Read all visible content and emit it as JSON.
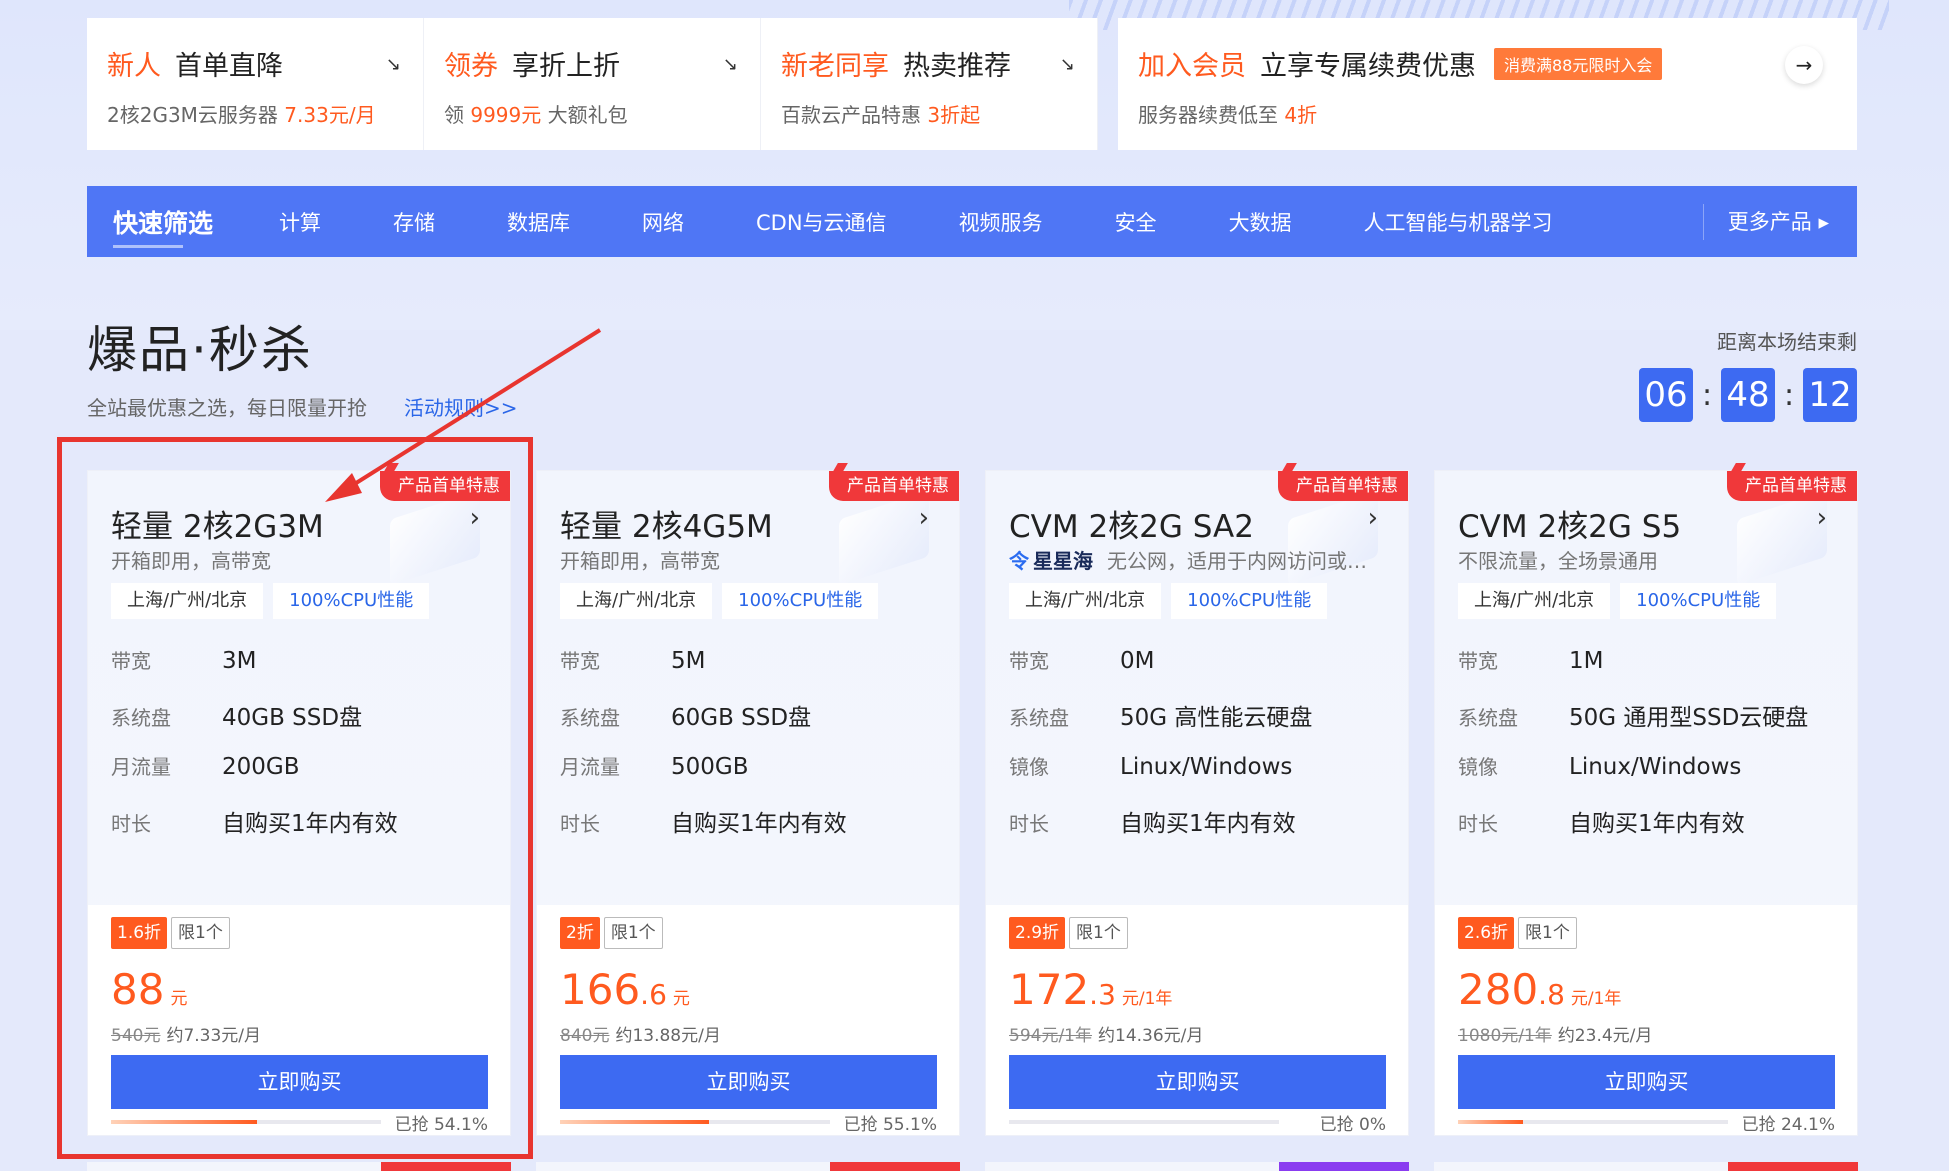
{
  "promos": [
    {
      "hl": "新人",
      "title": "首单直降",
      "sub_pre": "2核2G3M云服务器 ",
      "sub_hl": "7.33元/月",
      "sub_post": "",
      "arrow": "↘"
    },
    {
      "hl": "领券",
      "title": "享折上折",
      "sub_pre": "领 ",
      "sub_hl": "9999元",
      "sub_post": " 大额礼包",
      "arrow": "↘"
    },
    {
      "hl": "新老同享",
      "title": "热卖推荐",
      "sub_pre": "百款云产品特惠 ",
      "sub_hl": "3折起",
      "sub_post": "",
      "arrow": "↘"
    },
    {
      "hl": "加入会员",
      "title": "立享专属续费优惠",
      "badge": "消费满88元限时入会",
      "sub_pre": "服务器续费低至 ",
      "sub_hl": "4折",
      "sub_post": "",
      "arrow": "→"
    }
  ],
  "nav": {
    "quick": "快速筛选",
    "items": [
      "计算",
      "存储",
      "数据库",
      "网络",
      "CDN与云通信",
      "视频服务",
      "安全",
      "大数据",
      "人工智能与机器学习"
    ],
    "more": "更多产品 ▸"
  },
  "section": {
    "title": "爆品·秒杀",
    "subtitle": "全站最优惠之选，每日限量开抢",
    "rule_link": "活动规则>>",
    "countdown_label": "距离本场结束剩",
    "countdown": [
      "06",
      "48",
      "12"
    ],
    "countdown_sep": ":"
  },
  "cards": [
    {
      "tag": "产品首单特惠",
      "name": "轻量 2核2G3M",
      "chevron": "›",
      "desc": "开箱即用，高带宽",
      "chips": [
        "上海/广州/北京",
        "100%CPU性能"
      ],
      "specs": [
        {
          "k": "带宽",
          "v": "3M"
        },
        {
          "k": "系统盘",
          "v": "40GB SSD盘"
        },
        {
          "k": "月流量",
          "v": "200GB"
        },
        {
          "k": "时长",
          "v": "自购买1年内有效"
        }
      ],
      "discount": "1.6折",
      "limit": "限1个",
      "price_int": "88",
      "price_dec": "",
      "price_unit": "元",
      "orig_price": "540元",
      "monthly": "约7.33元/月",
      "buy": "立即购买",
      "progress": 0.541,
      "progress_text": "已抢 54.1%"
    },
    {
      "tag": "产品首单特惠",
      "name": "轻量 2核4G5M",
      "chevron": "›",
      "desc": "开箱即用，高带宽",
      "chips": [
        "上海/广州/北京",
        "100%CPU性能"
      ],
      "specs": [
        {
          "k": "带宽",
          "v": "5M"
        },
        {
          "k": "系统盘",
          "v": "60GB SSD盘"
        },
        {
          "k": "月流量",
          "v": "500GB"
        },
        {
          "k": "时长",
          "v": "自购买1年内有效"
        }
      ],
      "discount": "2折",
      "limit": "限1个",
      "price_int": "166",
      "price_dec": ".6",
      "price_unit": "元",
      "orig_price": "840元",
      "monthly": "约13.88元/月",
      "buy": "立即购买",
      "progress": 0.551,
      "progress_text": "已抢 55.1%"
    },
    {
      "tag": "产品首单特惠",
      "name": "CVM 2核2G SA2",
      "chevron": "›",
      "desc_brand_icon": "令",
      "desc_brand": "星星海",
      "desc": "无公网，适用于内网访问或…",
      "chips": [
        "上海/广州/北京",
        "100%CPU性能"
      ],
      "specs": [
        {
          "k": "带宽",
          "v": "0M"
        },
        {
          "k": "系统盘",
          "v": "50G 高性能云硬盘"
        },
        {
          "k": "镜像",
          "v": "Linux/Windows"
        },
        {
          "k": "时长",
          "v": "自购买1年内有效"
        }
      ],
      "discount": "2.9折",
      "limit": "限1个",
      "price_int": "172",
      "price_dec": ".3",
      "price_unit": "元/1年",
      "orig_price": "594元/1年",
      "monthly": "约14.36元/月",
      "buy": "立即购买",
      "progress": 0.0,
      "progress_text": "已抢 0%"
    },
    {
      "tag": "产品首单特惠",
      "name": "CVM 2核2G S5",
      "chevron": "›",
      "desc": "不限流量，全场景通用",
      "chips": [
        "上海/广州/北京",
        "100%CPU性能"
      ],
      "specs": [
        {
          "k": "带宽",
          "v": "1M"
        },
        {
          "k": "系统盘",
          "v": "50G 通用型SSD云硬盘"
        },
        {
          "k": "镜像",
          "v": "Linux/Windows"
        },
        {
          "k": "时长",
          "v": "自购买1年内有效"
        }
      ],
      "discount": "2.6折",
      "limit": "限1个",
      "price_int": "280",
      "price_dec": ".8",
      "price_unit": "元/1年",
      "orig_price": "1080元/1年",
      "monthly": "约23.4元/月",
      "buy": "立即购买",
      "progress": 0.241,
      "progress_text": "已抢 24.1%"
    }
  ],
  "colors": {
    "accent": "#3d6af2",
    "nav": "#4f76f5",
    "price": "#ff5a1f",
    "tag": "#f0383a",
    "annotation": "#e8352f"
  }
}
